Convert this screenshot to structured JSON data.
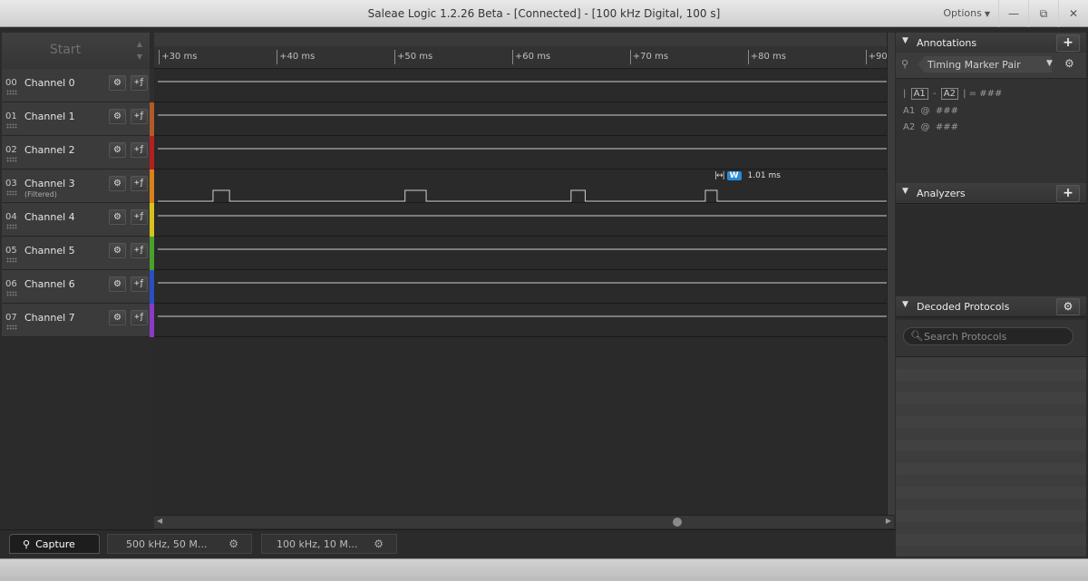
{
  "window": {
    "title": "Saleae Logic 1.2.26 Beta - [Connected] - [100 kHz Digital, 100 s]",
    "options_label": "Options",
    "min_glyph": "—",
    "restore_glyph": "⧉",
    "close_glyph": "✕"
  },
  "start_button": "Start",
  "channels": [
    {
      "num": "00",
      "name": "Channel 0",
      "sub": "",
      "color": "#2e2e2e"
    },
    {
      "num": "01",
      "name": "Channel 1",
      "sub": "",
      "color": "#b25a27"
    },
    {
      "num": "02",
      "name": "Channel 2",
      "sub": "",
      "color": "#b51f1f"
    },
    {
      "num": "03",
      "name": "Channel 3",
      "sub": "(Filtered)",
      "color": "#d9821c"
    },
    {
      "num": "04",
      "name": "Channel 4",
      "sub": "",
      "color": "#d8c11f"
    },
    {
      "num": "05",
      "name": "Channel 5",
      "sub": "",
      "color": "#4aa02c"
    },
    {
      "num": "06",
      "name": "Channel 6",
      "sub": "",
      "color": "#2b4ec2"
    },
    {
      "num": "07",
      "name": "Channel 7",
      "sub": "",
      "color": "#8a3bc9"
    }
  ],
  "channel_buttons": {
    "settings_icon": "gear-icon",
    "trigger_icon": "trigger-icon",
    "gear_glyph": "⚙",
    "trigger_glyph": "+ƒ"
  },
  "ruler": {
    "labels": [
      "+30 ms",
      "+40 ms",
      "+50 ms",
      "+60 ms",
      "+70 ms",
      "+80 ms",
      "+90"
    ],
    "view_start_ms": 29.6,
    "view_end_ms": 91.8
  },
  "channel3_pulses_ms": [
    [
      34.6,
      36.0
    ],
    [
      50.9,
      52.7
    ],
    [
      65.0,
      66.2
    ],
    [
      76.4,
      77.4
    ]
  ],
  "measurement": {
    "badge": "W",
    "value": "1.01 ms"
  },
  "tabs": [
    {
      "label": "Capture",
      "icon": "capture-search-icon"
    },
    {
      "label": "500 kHz, 50 M...",
      "icon": "gear-icon"
    },
    {
      "label": "100 kHz, 10 M...",
      "icon": "gear-icon"
    }
  ],
  "annotations": {
    "title": "Annotations",
    "add_glyph": "+",
    "marker_pair_label": "Timing Marker Pair",
    "a1": "A1",
    "a2": "A2",
    "diff_value": "###",
    "a1_at": "###",
    "a2_at": "###"
  },
  "analyzers": {
    "title": "Analyzers",
    "add_glyph": "+"
  },
  "decoded": {
    "title": "Decoded Protocols",
    "search_placeholder": "Search Protocols"
  }
}
